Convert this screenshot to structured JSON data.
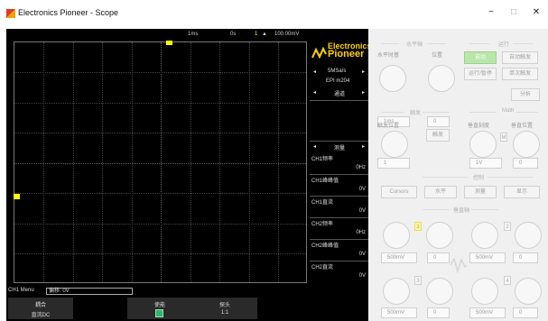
{
  "window": {
    "title": "Electronics Pioneer - Scope",
    "minimize": "−",
    "maximize": "□",
    "close": "✕"
  },
  "scope": {
    "time_div": "1ms",
    "delay": "0s",
    "trig_ch": "1",
    "trig_symbol": "▲",
    "trig_level": "100.00mV"
  },
  "info": {
    "brand_top": "Electronics",
    "brand_bottom": "Pioneer",
    "rate_prev": "◂",
    "rate": "5MSa/s",
    "rate_next": "▸",
    "model": "EPI m204",
    "sec1_prev": "◂",
    "sec1": "通道",
    "sec1_next": "▸",
    "sec2_prev": "◂",
    "sec2": "测量",
    "sec2_next": "▸",
    "meas": [
      {
        "label": "CH1频率",
        "value": "0Hz"
      },
      {
        "label": "CH1峰峰值",
        "value": "0V"
      },
      {
        "label": "CH1直流",
        "value": "0V"
      },
      {
        "label": "CH2频率",
        "value": "0Hz"
      },
      {
        "label": "CH2峰峰值",
        "value": "0V"
      },
      {
        "label": "CH2直流",
        "value": "0V"
      }
    ]
  },
  "status": {
    "menu": "CH1 Menu",
    "offset": "偏移: 0V"
  },
  "softkeys": [
    {
      "top": "耦合",
      "bottom": "直流DC"
    },
    {
      "top": "使能",
      "bottom": ""
    },
    {
      "top": "探头",
      "bottom": "1:1"
    }
  ],
  "panel": {
    "horizontal": "水平轴",
    "horiz_scale_label": "水平时基",
    "position_label": "位置",
    "time_value": "1ms",
    "pos_value": "0",
    "run": "运行",
    "auto_btn": "自动",
    "auto_trigger_btn": "自动触发",
    "run_stop_btn": "运行/暂停",
    "single_btn": "单次触发",
    "analysis_btn": "分析",
    "trigger": "触发",
    "trig_pos_label": "触发位置",
    "trig_btn": "触发",
    "trig_value": "1",
    "math": "Math",
    "vertical_label": "垂直刻度",
    "vpos_label": "垂直位置",
    "math_m": "M",
    "math_scale": "1V",
    "math_pos": "0",
    "control": "控制",
    "cursors_btn": "Cursors",
    "horiz_btn": "水平",
    "meas_btn": "测量",
    "display_btn": "显示",
    "vertical": "垂直轴",
    "ch_scales": [
      "500mV",
      "500mV",
      "500mV",
      "500mV"
    ],
    "ch_pos": [
      "0",
      "0",
      "0",
      "0"
    ],
    "ch_nums": [
      "1",
      "2",
      "3",
      "4"
    ]
  }
}
